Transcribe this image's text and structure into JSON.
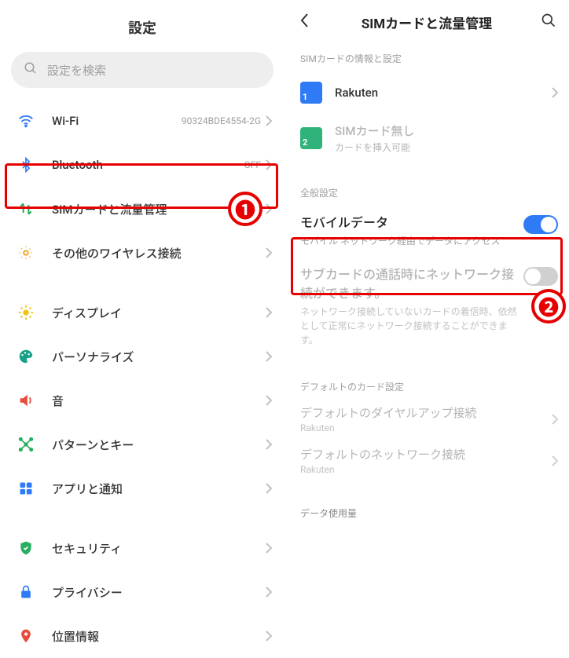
{
  "left": {
    "title": "設定",
    "search_placeholder": "設定を検索",
    "items": [
      {
        "icon": "wifi",
        "color": "#2f7af5",
        "label": "Wi-Fi",
        "value": "90324BDE4554-2G"
      },
      {
        "icon": "bluetooth",
        "color": "#2f7af5",
        "label": "Bluetooth",
        "value": "OFF"
      },
      {
        "icon": "sim",
        "color": "#27ae60",
        "label": "SIMカードと流量管理",
        "value": ""
      },
      {
        "icon": "wireless",
        "color": "#f39c12",
        "label": "その他のワイヤレス接続",
        "value": ""
      },
      {
        "icon": "display",
        "color": "#f1c40f",
        "label": "ディスプレイ",
        "value": ""
      },
      {
        "icon": "palette",
        "color": "#16a085",
        "label": "パーソナライズ",
        "value": ""
      },
      {
        "icon": "sound",
        "color": "#e74c3c",
        "label": "音",
        "value": ""
      },
      {
        "icon": "pattern",
        "color": "#27ae60",
        "label": "パターンとキー",
        "value": ""
      },
      {
        "icon": "apps",
        "color": "#2f7af5",
        "label": "アプリと通知",
        "value": ""
      },
      {
        "icon": "security",
        "color": "#27ae60",
        "label": "セキュリティ",
        "value": ""
      },
      {
        "icon": "privacy",
        "color": "#2f7af5",
        "label": "プライバシー",
        "value": ""
      },
      {
        "icon": "location",
        "color": "#e74c3c",
        "label": "位置情報",
        "value": ""
      }
    ]
  },
  "right": {
    "title": "SIMカードと流量管理",
    "section_sim": "SIMカードの情報と設定",
    "sim1": {
      "label": "Rakuten"
    },
    "sim2": {
      "label": "SIMカード無し",
      "sub": "カードを挿入可能"
    },
    "section_general": "全般設定",
    "mobile_data": {
      "title": "モバイルデータ",
      "desc": "モバイル ネットワーク経由でデータにアクセス"
    },
    "subcard": {
      "title": "サブカードの通話時にネットワーク接続ができます。",
      "desc": "ネットワーク接続していないカードの着信時、依然として正常にネットワーク接続することができます。"
    },
    "section_default": "デフォルトのカード設定",
    "default_dial": {
      "title": "デフォルトのダイヤルアップ接続",
      "sub": "Rakuten"
    },
    "default_net": {
      "title": "デフォルトのネットワーク接続",
      "sub": "Rakuten"
    },
    "section_datausage": "データ使用量"
  },
  "annotations": {
    "badge1": "❶",
    "badge2": "❷"
  }
}
